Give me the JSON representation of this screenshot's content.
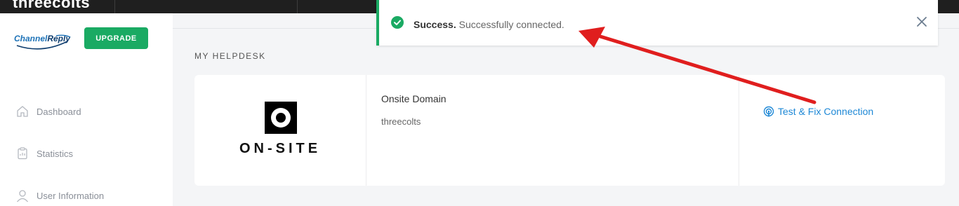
{
  "topbar": {
    "brand": "threecolts"
  },
  "sidebar": {
    "logo": {
      "part1": "Channel",
      "part2": "Reply"
    },
    "upgrade_label": "UPGRADE",
    "items": [
      {
        "label": "Dashboard",
        "icon": "home-icon"
      },
      {
        "label": "Statistics",
        "icon": "clipboard-icon"
      },
      {
        "label": "User Information",
        "icon": "user-icon"
      }
    ]
  },
  "main": {
    "section_title": "MY HELPDESK",
    "helpdesk": {
      "logo_text": "ON-SITE",
      "name": "Onsite Domain",
      "subdomain": "threecolts",
      "action_label": "Test & Fix Connection",
      "action_icon": "broadcast-icon"
    }
  },
  "toast": {
    "title": "Success.",
    "message": "Successfully connected.",
    "icon": "check-circle-icon",
    "close_icon": "close-icon"
  },
  "colors": {
    "accent_green": "#1aaa63",
    "link_blue": "#1e88d6",
    "annotation_red": "#e01e1e"
  }
}
